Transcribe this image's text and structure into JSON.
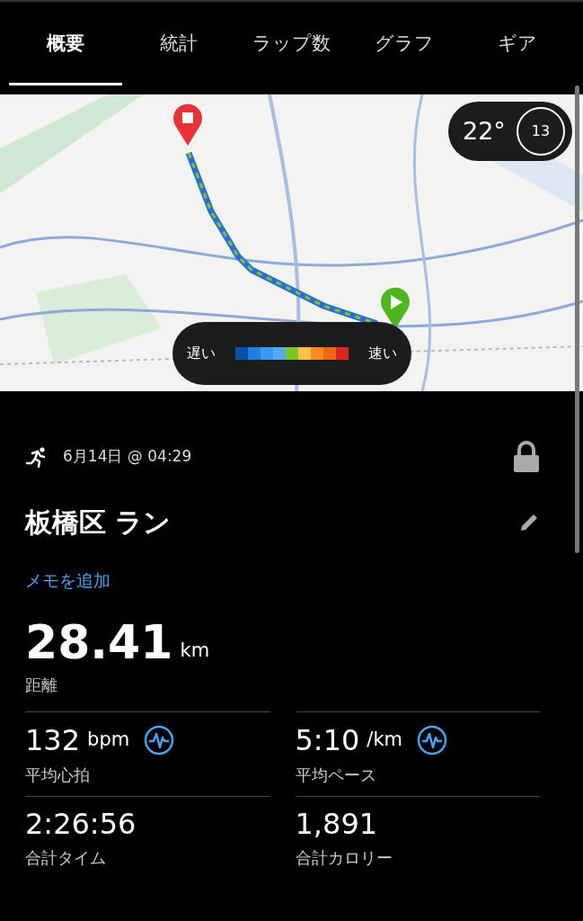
{
  "tabs": [
    {
      "label": "概要",
      "selected": true
    },
    {
      "label": "統計",
      "selected": false
    },
    {
      "label": "ラップ数",
      "selected": false
    },
    {
      "label": "グラフ",
      "selected": false
    },
    {
      "label": "ギア",
      "selected": false
    }
  ],
  "map": {
    "kind": "picture",
    "weather": {
      "temperature": "22°",
      "wind": "13"
    },
    "legend": {
      "slow": "遅い",
      "fast": "速い",
      "swatches": [
        {
          "color": "#0a4fa8"
        },
        {
          "color": "#1f7fe0"
        },
        {
          "color": "#3a9af0"
        },
        {
          "color": "#55aaf5"
        },
        {
          "color": "#7cc62a"
        },
        {
          "color": "#f7c243"
        },
        {
          "color": "#f58a26"
        },
        {
          "color": "#ee6a12"
        },
        {
          "color": "#dc2525"
        }
      ]
    }
  },
  "activity": {
    "date": "6月14日 @ 04:29",
    "title": "板橋区 ラン",
    "add_note": "メモを追加"
  },
  "distance": {
    "value": "28.41",
    "unit": "km",
    "label": "距離"
  },
  "stats": [
    {
      "value": "132",
      "unit": "bpm",
      "label": "平均心拍",
      "kind": "zoned"
    },
    {
      "value": "5:10",
      "unit": "/km",
      "label": "平均ペース",
      "kind": "zoned"
    },
    {
      "value": "2:26:56",
      "label": "合計タイム",
      "kind": "plain"
    },
    {
      "value": "1,891",
      "label": "合計カロリー",
      "kind": "plain"
    }
  ]
}
